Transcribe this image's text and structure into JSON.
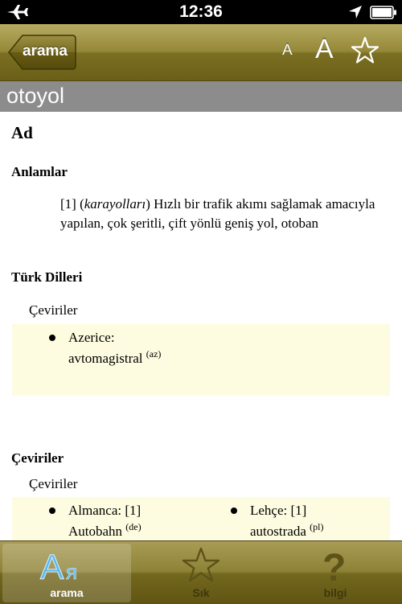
{
  "status_bar": {
    "time": "12:36"
  },
  "nav": {
    "back_label": "arama",
    "font_small": "A",
    "font_large": "A"
  },
  "title": "otoyol",
  "entry": {
    "part_of_speech": "Ad",
    "meanings_heading": "Anlamlar",
    "meaning": {
      "number": "[1]",
      "domain": "karayolları",
      "text": "Hızlı bir trafik akımı sağlamak amacıyla yapılan, çok şeritli, çift yönlü geniş yol, otoban"
    },
    "turkic_heading": "Türk Dilleri",
    "turkic_translations_label": "Çeviriler",
    "turkic_translations": [
      {
        "language": "Azerice:",
        "word": "avtomagistral",
        "code": "(az)"
      }
    ],
    "translations_heading": "Çeviriler",
    "translations_label": "Çeviriler",
    "translations": [
      {
        "language": "Almanca: [1]",
        "word": "Autobahn",
        "code": "(de)"
      },
      {
        "language": "Lehçe: [1]",
        "word": "autostrada",
        "code": "(pl)"
      }
    ]
  },
  "tabs": [
    {
      "label": "arama",
      "icon": "dictionary-icon",
      "active": true
    },
    {
      "label": "Sık",
      "icon": "star-icon",
      "active": false
    },
    {
      "label": "bilgi",
      "icon": "question-mark-icon",
      "active": false
    }
  ],
  "colors": {
    "nav_bar": "#958838",
    "title_bar": "#8c8c8c",
    "translation_box": "#fefce0",
    "active_tab_icon": "#5bb8f0",
    "inactive_tab_icon": "#5d5318"
  }
}
